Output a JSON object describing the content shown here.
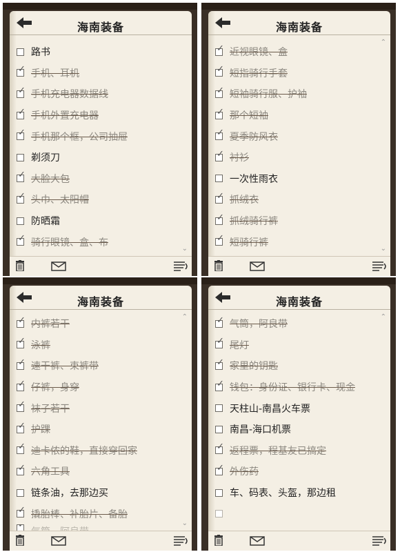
{
  "panels": [
    {
      "title": "海南装备",
      "items": [
        {
          "label": "路书",
          "checked": false
        },
        {
          "label": "手机、耳机",
          "checked": true
        },
        {
          "label": "手机充电器数据线",
          "checked": true
        },
        {
          "label": "手机外置充电器",
          "checked": true
        },
        {
          "label": "手机那个框，公司抽屉",
          "checked": true
        },
        {
          "label": "剃须刀",
          "checked": false
        },
        {
          "label": "大脸大包",
          "checked": true
        },
        {
          "label": "头巾、太阳帽",
          "checked": true
        },
        {
          "label": "防晒霜",
          "checked": false
        },
        {
          "label": "骑行眼镜、盒、布",
          "checked": true
        }
      ]
    },
    {
      "title": "海南装备",
      "items": [
        {
          "label": "近视眼镜、盒",
          "checked": true
        },
        {
          "label": "短指骑行手套",
          "checked": true
        },
        {
          "label": "短袖骑行服、护袖",
          "checked": true
        },
        {
          "label": "那个短袖",
          "checked": true
        },
        {
          "label": "夏季防风衣",
          "checked": true
        },
        {
          "label": "衬衫",
          "checked": true
        },
        {
          "label": "一次性雨衣",
          "checked": false
        },
        {
          "label": "抓绒衣",
          "checked": true
        },
        {
          "label": "抓绒骑行裤",
          "checked": true
        },
        {
          "label": "短骑行裤",
          "checked": true
        }
      ]
    },
    {
      "title": "海南装备",
      "items": [
        {
          "label": "内裤若干",
          "checked": true
        },
        {
          "label": "泳裤",
          "checked": true
        },
        {
          "label": "速干裤、束裤带",
          "checked": true
        },
        {
          "label": "仔裤，身穿",
          "checked": true
        },
        {
          "label": "袜子若干",
          "checked": true
        },
        {
          "label": "护踝",
          "checked": true
        },
        {
          "label": "迪卡侬的鞋，直接穿回家",
          "checked": true
        },
        {
          "label": "六角工具",
          "checked": true
        },
        {
          "label": "链条油，去那边买",
          "checked": false
        },
        {
          "label": "撬胎棒、补胎片、备胎",
          "checked": true
        },
        {
          "label": "气筒，阿良带",
          "checked": true
        }
      ]
    },
    {
      "title": "海南装备",
      "items": [
        {
          "label": "气筒，阿良带",
          "checked": true
        },
        {
          "label": "尾灯",
          "checked": true
        },
        {
          "label": "家里的钥匙",
          "checked": true
        },
        {
          "label": "钱包：身份证、银行卡、现金",
          "checked": true
        },
        {
          "label": "天柱山-南昌火车票",
          "checked": false
        },
        {
          "label": "南昌-海口机票",
          "checked": false
        },
        {
          "label": "返程票，程基友已搞定",
          "checked": true
        },
        {
          "label": "外伤药",
          "checked": true
        },
        {
          "label": "车、码表、头盔，那边租",
          "checked": false
        },
        {
          "label": "",
          "checked": false
        }
      ]
    }
  ]
}
